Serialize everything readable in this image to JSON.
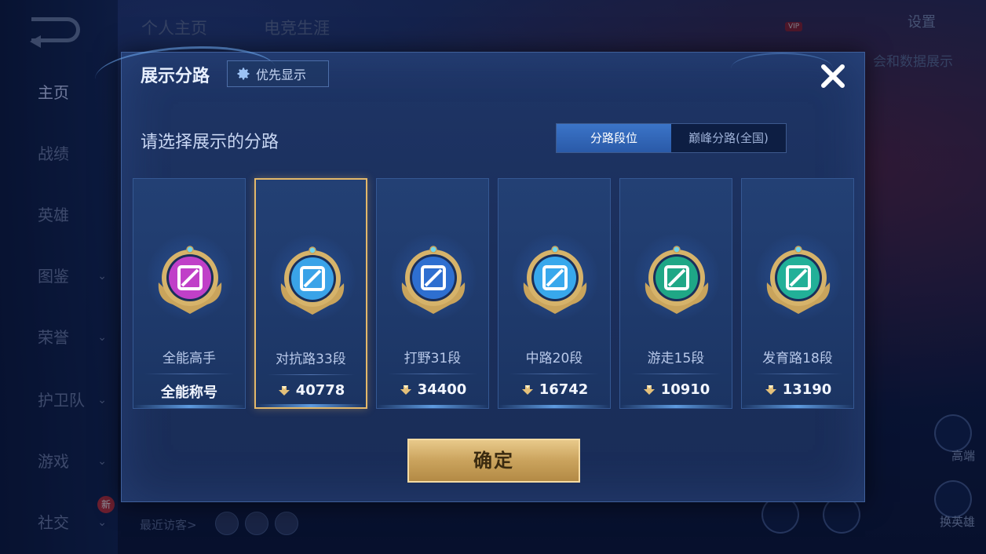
{
  "background": {
    "nav": [
      {
        "label": "主页",
        "active": true,
        "has_chevron": false
      },
      {
        "label": "战绩",
        "active": false,
        "has_chevron": false
      },
      {
        "label": "英雄",
        "active": false,
        "has_chevron": false
      },
      {
        "label": "图鉴",
        "active": false,
        "has_chevron": true
      },
      {
        "label": "荣誉",
        "active": false,
        "has_chevron": true
      },
      {
        "label": "护卫队",
        "active": false,
        "has_chevron": true
      },
      {
        "label": "游戏",
        "active": false,
        "has_chevron": true
      },
      {
        "label": "社交",
        "active": false,
        "has_chevron": true
      }
    ],
    "new_badge": "新",
    "tabs": [
      "个人主页",
      "电竞生涯"
    ],
    "settings_label": "设置",
    "vip_tag": "VIP",
    "right_label": "会和数据展示",
    "side_buttons": [
      "高端",
      "换英雄"
    ],
    "recent_visitors_label": "最近访客>"
  },
  "modal": {
    "title": "展示分路",
    "priority_label": "优先显示",
    "subtitle": "请选择展示的分路",
    "toggle": {
      "options": [
        "分路段位",
        "巅峰分路(全国)"
      ],
      "active_index": 0
    },
    "cards": [
      {
        "name": "全能高手",
        "value": "全能称号",
        "has_score_icon": false,
        "selected": false,
        "emblem": "all-round-emblem-icon",
        "color": "#c040c8"
      },
      {
        "name": "对抗路33段",
        "value": "40778",
        "has_score_icon": true,
        "selected": true,
        "emblem": "clash-lane-emblem-icon",
        "color": "#3aa3e8"
      },
      {
        "name": "打野31段",
        "value": "34400",
        "has_score_icon": true,
        "selected": false,
        "emblem": "jungle-emblem-icon",
        "color": "#2e6fd0"
      },
      {
        "name": "中路20段",
        "value": "16742",
        "has_score_icon": true,
        "selected": false,
        "emblem": "mid-lane-emblem-icon",
        "color": "#38a8ec"
      },
      {
        "name": "游走15段",
        "value": "10910",
        "has_score_icon": true,
        "selected": false,
        "emblem": "roam-emblem-icon",
        "color": "#1fa786"
      },
      {
        "name": "发育路18段",
        "value": "13190",
        "has_score_icon": true,
        "selected": false,
        "emblem": "farm-lane-emblem-icon",
        "color": "#22b098"
      }
    ],
    "confirm_label": "确定"
  }
}
